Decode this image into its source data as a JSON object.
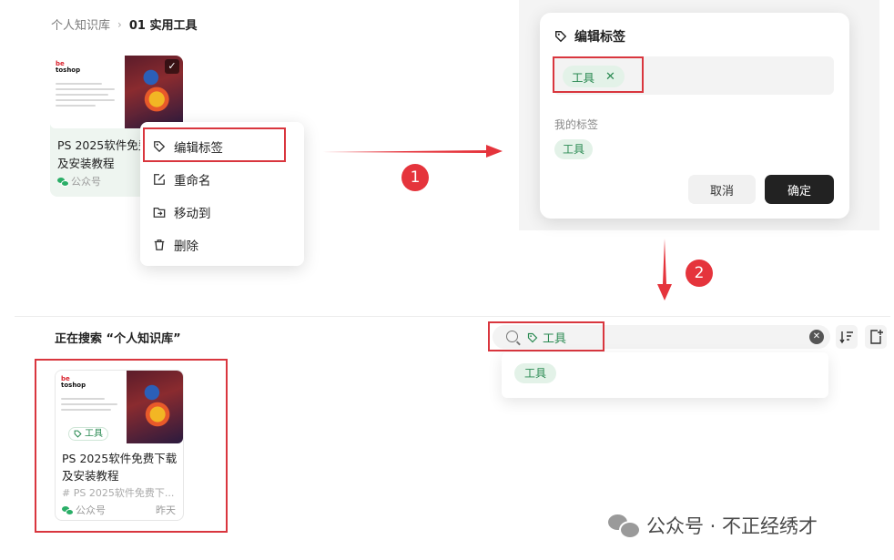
{
  "top_left": {
    "breadcrumb": {
      "root": "个人知识库",
      "current": "01 实用工具"
    },
    "card": {
      "thumbnail": {
        "logo_line1": "be",
        "logo_line2": "toshop"
      },
      "title": "PS 2025软件免费下载及安装教程",
      "title_visible": "PS 2025软件免费\n及安装教程",
      "source": "公众号"
    },
    "context_menu": {
      "items": [
        {
          "label": "编辑标签",
          "icon": "tag-icon"
        },
        {
          "label": "重命名",
          "icon": "rename-icon"
        },
        {
          "label": "移动到",
          "icon": "move-folder-icon"
        },
        {
          "label": "删除",
          "icon": "trash-icon"
        }
      ]
    }
  },
  "steps": {
    "step1": "1",
    "step2": "2"
  },
  "edit_tag_dialog": {
    "title": "编辑标签",
    "current_tag": "工具",
    "my_tags_label": "我的标签",
    "my_tags": [
      "工具"
    ],
    "cancel_label": "取消",
    "confirm_label": "确定"
  },
  "search_panel": {
    "heading": "正在搜索 “个人知识库”",
    "search_tag": "工具",
    "dropdown_tag": "工具",
    "result_card": {
      "thumb_tag": "工具",
      "title": "PS 2025软件免费下载及安装教程",
      "snippet": "# PS 2025软件免费下...",
      "source": "公众号",
      "time": "昨天"
    }
  },
  "watermark": "公众号 · 不正经绣才",
  "colors": {
    "highlight_red": "#d9363e",
    "badge_red": "#e5343c",
    "tag_green": "#2a8a52",
    "tag_bg": "#e3f2e8",
    "primary_dark": "#222222"
  }
}
